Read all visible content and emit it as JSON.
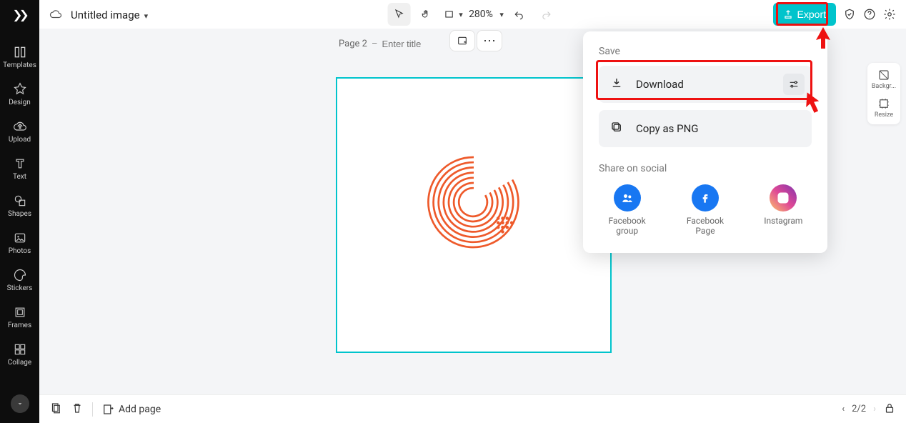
{
  "header": {
    "title": "Untitled image",
    "zoom": "280%",
    "export_label": "Export"
  },
  "sidebar": {
    "items": [
      {
        "label": "Templates"
      },
      {
        "label": "Design"
      },
      {
        "label": "Upload"
      },
      {
        "label": "Text"
      },
      {
        "label": "Shapes"
      },
      {
        "label": "Photos"
      },
      {
        "label": "Stickers"
      },
      {
        "label": "Frames"
      },
      {
        "label": "Collage"
      }
    ]
  },
  "page": {
    "label": "Page 2",
    "separator": "–",
    "title_placeholder": "Enter title"
  },
  "right_rail": {
    "items": [
      {
        "label": "Backgr..."
      },
      {
        "label": "Resize"
      }
    ]
  },
  "bottom": {
    "add_page": "Add page",
    "pager": "2/2"
  },
  "popover": {
    "save_heading": "Save",
    "download": "Download",
    "copy_png": "Copy as PNG",
    "share_heading": "Share on social",
    "share": [
      {
        "label": "Facebook group"
      },
      {
        "label": "Facebook Page"
      },
      {
        "label": "Instagram"
      }
    ]
  }
}
